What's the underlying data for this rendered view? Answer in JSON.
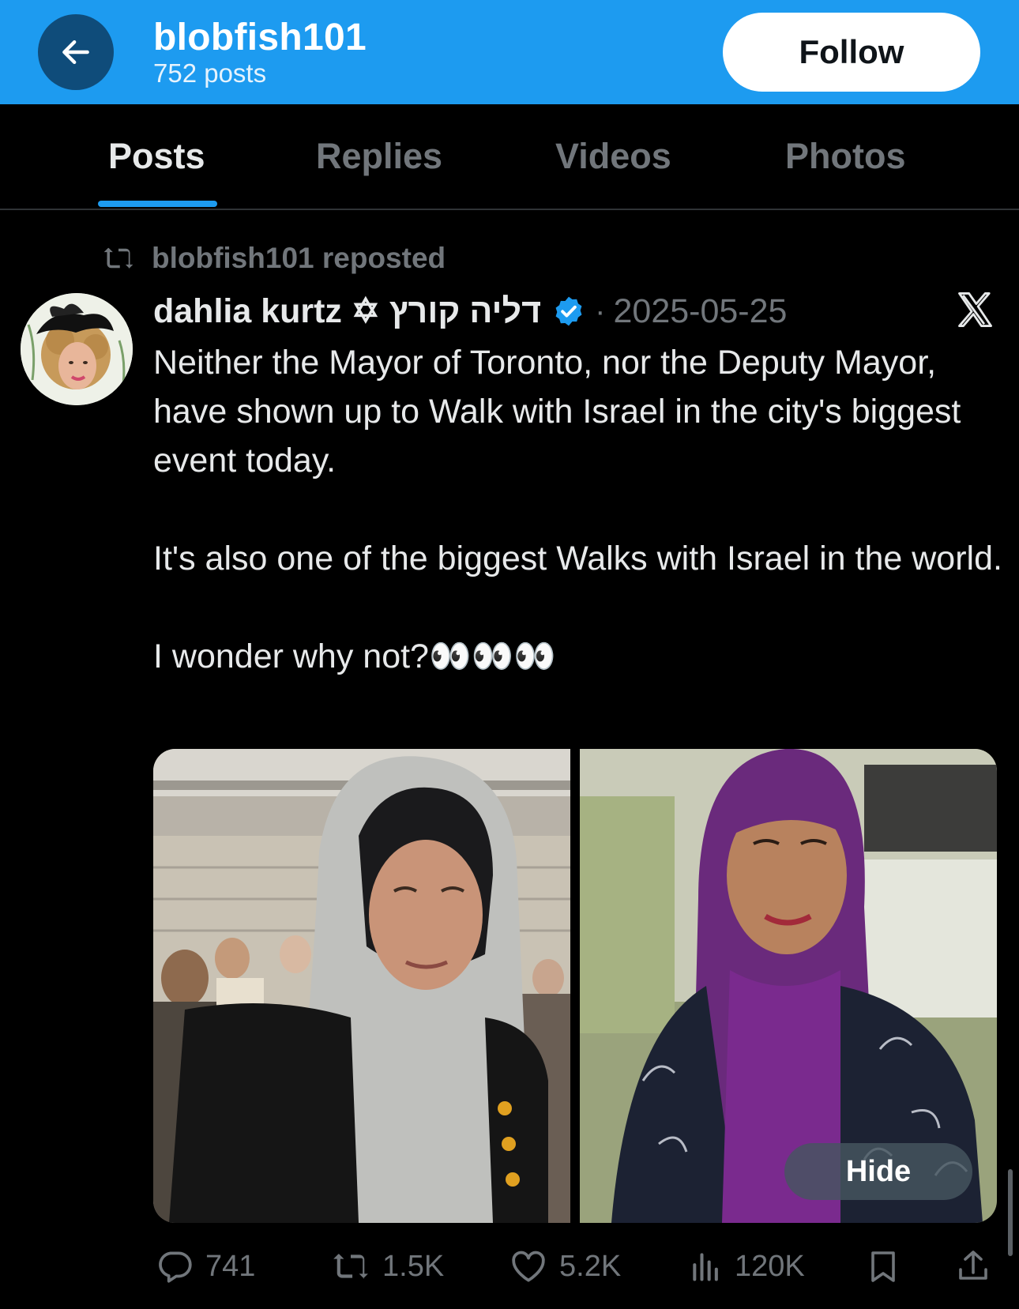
{
  "header": {
    "title": "blobfish101",
    "post_count": "752 posts",
    "follow_label": "Follow",
    "bg_color": "#1d9bf0"
  },
  "tabs": [
    {
      "label": "Posts",
      "active": true
    },
    {
      "label": "Replies",
      "active": false
    },
    {
      "label": "Videos",
      "active": false
    },
    {
      "label": "Photos",
      "active": false
    }
  ],
  "post": {
    "repost_text": "blobfish101 reposted",
    "author": "dahlia kurtz ✡ דליה קורץ",
    "verified": true,
    "date": "2025-05-25",
    "separator": "·",
    "paragraphs": [
      "Neither the Mayor of Toronto, nor the Deputy Mayor, have shown up to Walk with Israel in the city's biggest event today.",
      "It's also one of the biggest Walks with Israel in the world.",
      "I wonder why not?👀👀👀"
    ],
    "media_hide_label": "Hide",
    "stats": {
      "replies": "741",
      "reposts": "1.5K",
      "likes": "5.2K",
      "views": "120K"
    },
    "icons": [
      "repost-icon",
      "verified-badge-icon",
      "x-logo-icon",
      "reply-icon",
      "like-icon",
      "views-icon",
      "bookmark-icon",
      "share-icon"
    ]
  }
}
